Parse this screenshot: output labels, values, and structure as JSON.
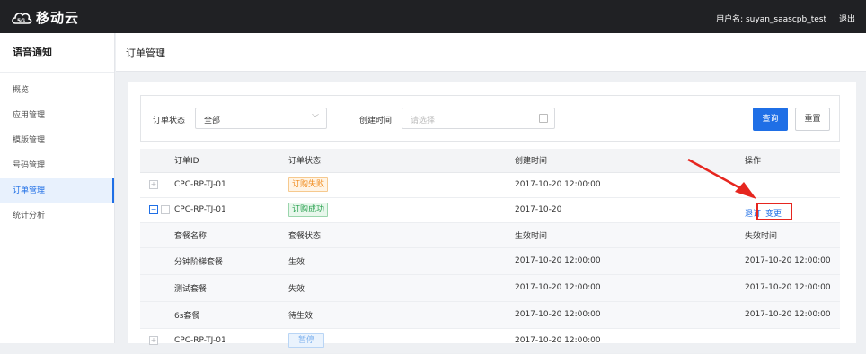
{
  "header": {
    "logo_text": "移动云",
    "username_label": "用户名: suyan_saascpb_test",
    "logout_label": "退出"
  },
  "sidebar": {
    "title": "语音通知",
    "items": [
      {
        "label": "概览"
      },
      {
        "label": "应用管理"
      },
      {
        "label": "模版管理"
      },
      {
        "label": "号码管理"
      },
      {
        "label": "订单管理"
      },
      {
        "label": "统计分析"
      }
    ]
  },
  "page": {
    "title": "订单管理"
  },
  "filter": {
    "status_label": "订单状态",
    "status_value": "全部",
    "time_label": "创建时间",
    "time_placeholder": "请选择",
    "search_label": "查询",
    "reset_label": "重置"
  },
  "table": {
    "headers": [
      "订单ID",
      "订单状态",
      "创建时间",
      "操作"
    ],
    "rows": [
      {
        "id": "CPC-RP-TJ-01",
        "status": "订购失败",
        "created": "2017-10-20 12:00:00"
      },
      {
        "id": "CPC-RP-TJ-01",
        "status": "订购成功",
        "created": "2017-10-20",
        "action_return": "退订",
        "action_change": "变更"
      },
      {
        "id": "CPC-RP-TJ-01",
        "status": "暂停",
        "created": "2017-10-20 12:00:00"
      }
    ],
    "sub_headers": [
      "套餐名称",
      "套餐状态",
      "生效时间",
      "失效时间"
    ],
    "sub_rows": [
      {
        "name": "分钟阶梯套餐",
        "status": "生效",
        "start": "2017-10-20 12:00:00",
        "end": "2017-10-20 12:00:00"
      },
      {
        "name": "测试套餐",
        "status": "失效",
        "start": "2017-10-20 12:00:00",
        "end": "2017-10-20 12:00:00"
      },
      {
        "name": "6s套餐",
        "status": "待生效",
        "start": "2017-10-20 12:00:00",
        "end": "2017-10-20 12:00:00"
      }
    ]
  },
  "colors": {
    "accent": "#1f6fe6",
    "annotation": "#e6261f"
  }
}
